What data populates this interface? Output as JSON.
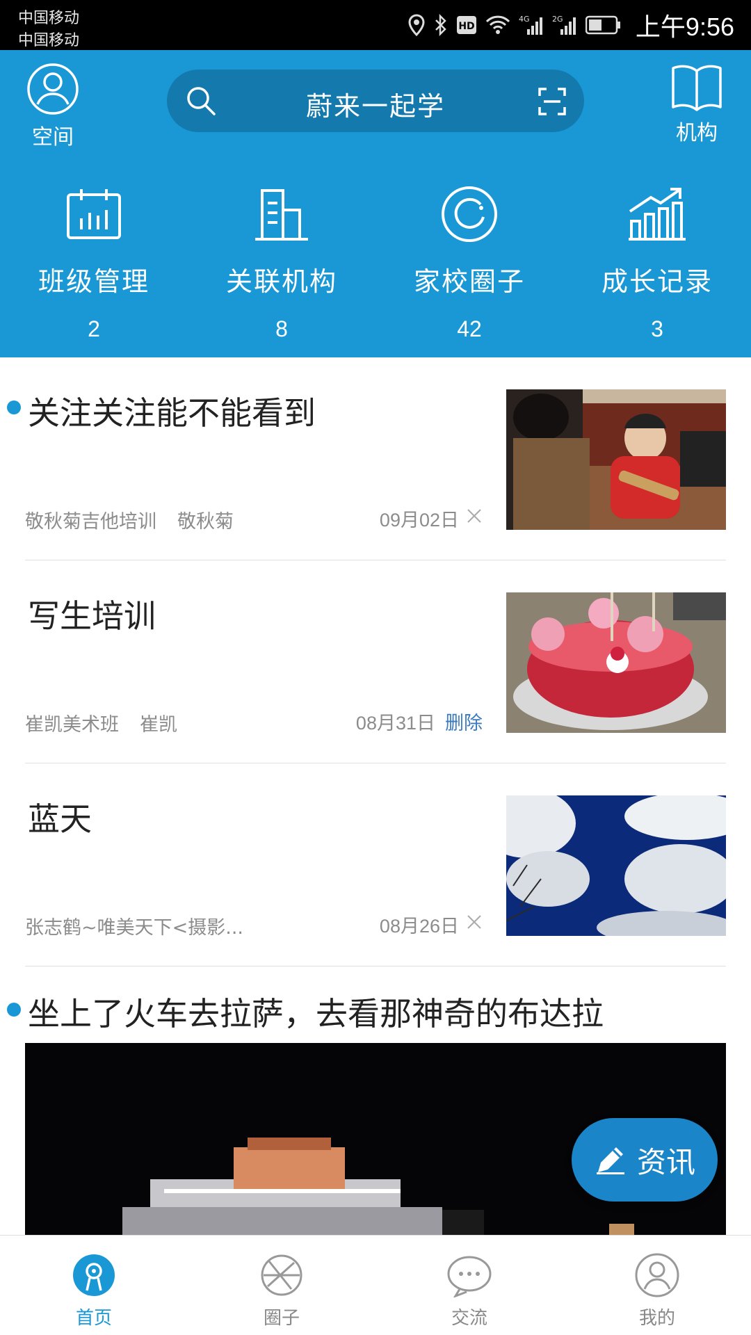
{
  "status_bar": {
    "carrier_1": "中国移动",
    "carrier_2": "中国移动",
    "time": "上午9:56",
    "icons": [
      "location-icon",
      "bluetooth-icon",
      "hd-icon",
      "wifi-icon",
      "signal-4g-icon",
      "signal-2g-icon",
      "battery-icon"
    ]
  },
  "header": {
    "left": {
      "label": "空间",
      "icon": "person-icon"
    },
    "search": {
      "text": "蔚来一起学",
      "icon": "search-icon",
      "scan_icon": "scan-icon"
    },
    "right": {
      "label": "机构",
      "icon": "book-icon"
    },
    "stats": [
      {
        "name": "班级管理",
        "count": "2",
        "icon": "calendar-icon"
      },
      {
        "name": "关联机构",
        "count": "8",
        "icon": "building-icon"
      },
      {
        "name": "家校圈子",
        "count": "42",
        "icon": "circle-icon"
      },
      {
        "name": "成长记录",
        "count": "3",
        "icon": "chart-icon"
      }
    ],
    "color": "#1a98d5"
  },
  "feed": {
    "items": [
      {
        "title": "关注关注能不能看到",
        "org": "敬秋菊吉他培训",
        "author": "敬秋菊",
        "date": "09月02日",
        "action": "×",
        "unread": true
      },
      {
        "title": "写生培训",
        "org": "崔凯美术班",
        "author": "崔凯",
        "date": "08月31日",
        "action": "删除",
        "unread": false
      },
      {
        "title": "蓝天",
        "org": "张志鹤~唯美天下<摄影...",
        "author": "",
        "date": "08月26日",
        "action": "×",
        "unread": false
      }
    ],
    "big_item": {
      "title": "坐上了火车去拉萨，去看那神奇的布达拉",
      "unread": true
    }
  },
  "fab": {
    "label": "资讯",
    "icon": "pencil-icon"
  },
  "tabbar": {
    "tabs": [
      {
        "label": "首页",
        "icon": "home-icon",
        "active": true
      },
      {
        "label": "圈子",
        "icon": "circles-icon",
        "active": false
      },
      {
        "label": "交流",
        "icon": "chat-icon",
        "active": false
      },
      {
        "label": "我的",
        "icon": "user-icon",
        "active": false
      }
    ]
  }
}
